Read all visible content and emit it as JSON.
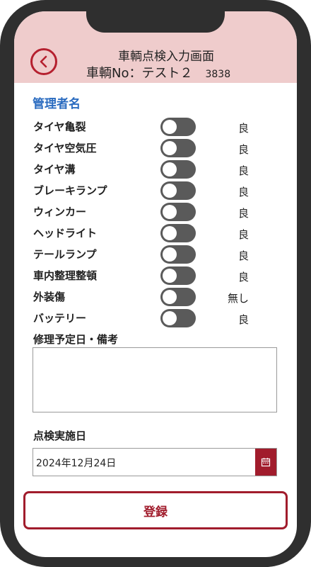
{
  "header": {
    "title": "車輌点検入力画面",
    "vehicle_label": "車輌No：テスト２",
    "vehicle_code": "3838"
  },
  "admin_name": "管理者名",
  "checks": [
    {
      "label": "タイヤ亀裂",
      "value": "良"
    },
    {
      "label": "タイヤ空気圧",
      "value": "良"
    },
    {
      "label": "タイヤ溝",
      "value": "良"
    },
    {
      "label": "ブレーキランプ",
      "value": "良"
    },
    {
      "label": "ウィンカー",
      "value": "良"
    },
    {
      "label": "ヘッドライト",
      "value": "良"
    },
    {
      "label": "テールランプ",
      "value": "良"
    },
    {
      "label": "車内整理整頓",
      "value": "良"
    },
    {
      "label": "外装傷",
      "value": "無し"
    },
    {
      "label": "バッテリー",
      "value": "良"
    }
  ],
  "notes": {
    "label": "修理予定日・備考",
    "value": ""
  },
  "inspection_date": {
    "label": "点検実施日",
    "value": "2024年12月24日"
  },
  "submit_label": "登録",
  "colors": {
    "accent": "#a11c2c",
    "header_bg": "#efcccc",
    "admin_text": "#2b6cc0",
    "toggle_off": "#5a5a5a"
  }
}
